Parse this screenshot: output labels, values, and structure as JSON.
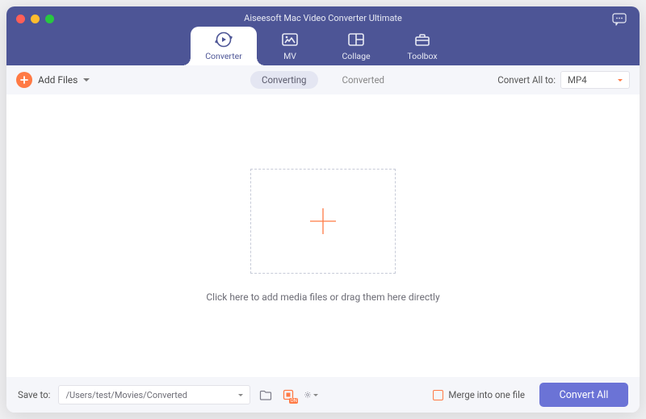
{
  "window": {
    "title": "Aiseesoft Mac Video Converter Ultimate"
  },
  "tabs": {
    "converter": "Converter",
    "mv": "MV",
    "collage": "Collage",
    "toolbox": "Toolbox"
  },
  "toolbar": {
    "add_files": "Add Files",
    "segment": {
      "converting": "Converting",
      "converted": "Converted"
    },
    "convert_all_to_label": "Convert All to:",
    "format_selected": "MP4"
  },
  "main": {
    "hint": "Click here to add media files or drag them here directly"
  },
  "footer": {
    "save_to_label": "Save to:",
    "save_to_path": "/Users/test/Movies/Converted",
    "merge_label": "Merge into one file",
    "convert_all_button": "Convert All"
  },
  "colors": {
    "accent": "#ff7a45",
    "primary": "#6b73d6",
    "titlebar": "#4d5596"
  }
}
